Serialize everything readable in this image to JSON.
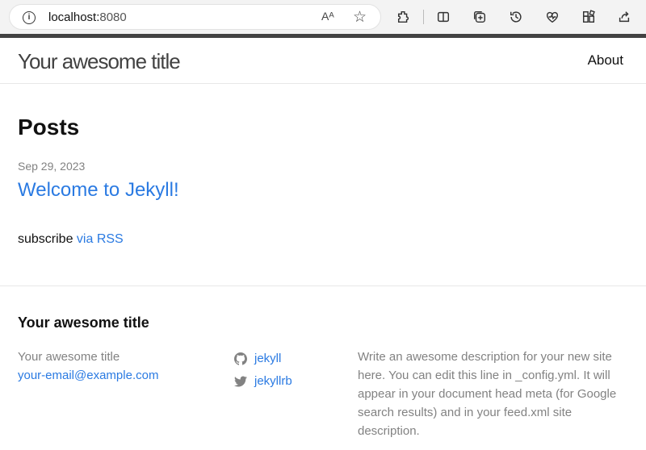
{
  "browser": {
    "url_host": "localhost:",
    "url_port": "8080",
    "read_aloud_glyph": "Aᴬ",
    "icons": [
      "info-icon",
      "read-aloud-icon",
      "favorite-star-icon",
      "extensions-icon",
      "split-screen-icon",
      "collections-icon",
      "history-icon",
      "performance-icon",
      "browser-essentials-icon",
      "share-icon"
    ]
  },
  "header": {
    "site_title": "Your awesome title",
    "nav_about": "About"
  },
  "main": {
    "heading": "Posts",
    "posts": [
      {
        "date": "Sep 29, 2023",
        "title": "Welcome to Jekyll!"
      }
    ],
    "rss_prefix": "subscribe ",
    "rss_link": "via RSS"
  },
  "footer": {
    "heading": "Your awesome title",
    "name": "Your awesome title",
    "email": "your-email@example.com",
    "social": [
      {
        "icon": "github-icon",
        "label": "jekyll"
      },
      {
        "icon": "twitter-icon",
        "label": "jekyllrb"
      }
    ],
    "description": "Write an awesome description for your new site here. You can edit this line in _config.yml. It will appear in your document head meta (for Google search results) and in your feed.xml site description."
  },
  "colors": {
    "link": "#2a7ae2",
    "muted": "#828282",
    "title": "#424242"
  }
}
